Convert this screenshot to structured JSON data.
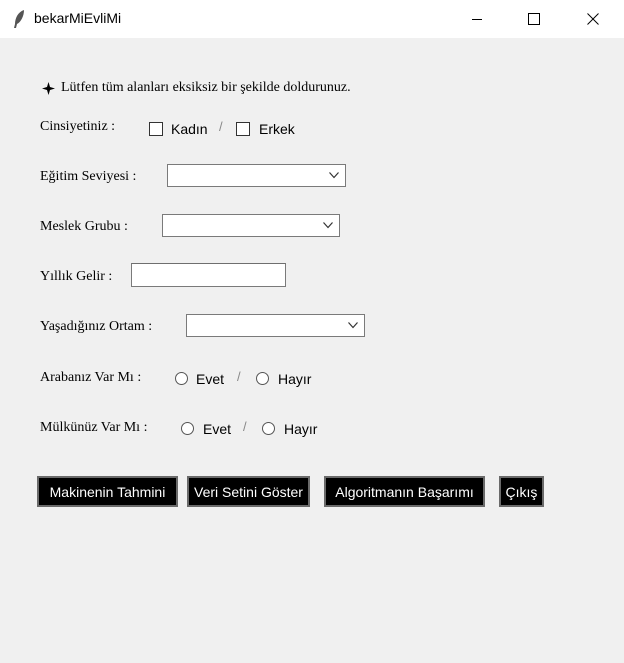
{
  "window": {
    "title": "bekarMiEvliMi"
  },
  "form": {
    "instruction": "Lütfen tüm alanları eksiksiz bir şekilde doldurunuz.",
    "gender": {
      "label": "Cinsiyetiniz :",
      "option_female": "Kadın",
      "option_male": "Erkek"
    },
    "education": {
      "label": "Eğitim Seviyesi :",
      "value": ""
    },
    "occupation": {
      "label": "Meslek Grubu :",
      "value": ""
    },
    "income": {
      "label": "Yıllık Gelir :",
      "value": ""
    },
    "environment": {
      "label": "Yaşadığınız Ortam :",
      "value": ""
    },
    "car": {
      "label": "Arabanız Var Mı :",
      "option_yes": "Evet",
      "option_no": "Hayır"
    },
    "property": {
      "label": "Mülkünüz Var Mı :",
      "option_yes": "Evet",
      "option_no": "Hayır"
    },
    "separator": "/"
  },
  "buttons": {
    "predict": "Makinenin Tahmini",
    "show_dataset": "Veri Setini Göster",
    "algorithm_score": "Algoritmanın Başarımı",
    "exit": "Çıkış"
  }
}
